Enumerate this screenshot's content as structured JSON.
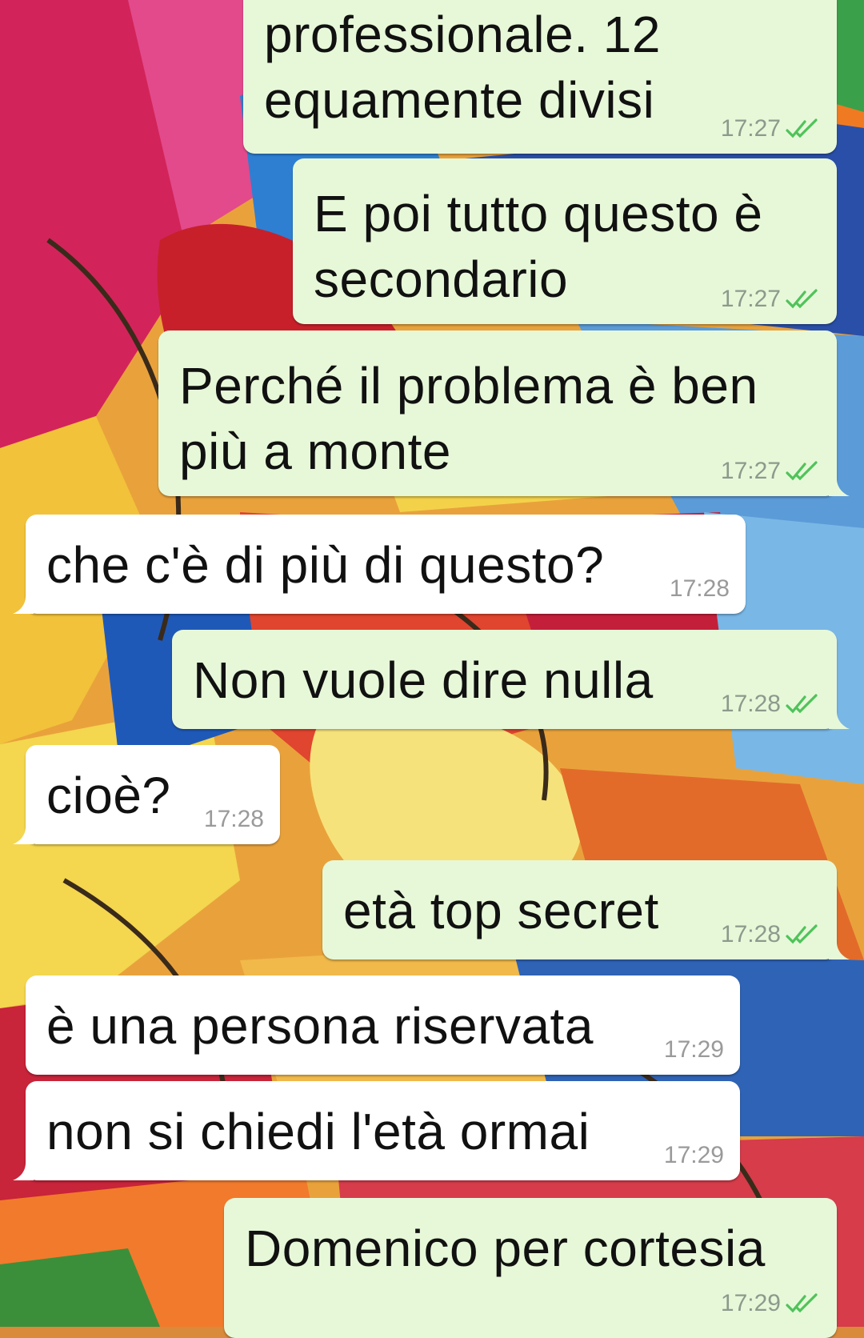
{
  "colors": {
    "outgoing_bubble": "#e7f8d9",
    "incoming_bubble": "#ffffff",
    "read_ticks": "#4fc35a",
    "timestamp": "#8c9a8c"
  },
  "messages": [
    {
      "direction": "outgoing",
      "text": "professionale. 12\nequamente divisi",
      "time": "17:27",
      "status": "read",
      "status_icon": "double-check-icon"
    },
    {
      "direction": "outgoing",
      "text": "E poi tutto questo è\nsecondario",
      "time": "17:27",
      "status": "read",
      "status_icon": "double-check-icon"
    },
    {
      "direction": "outgoing",
      "text": "Perché il problema è ben\npiù a monte",
      "time": "17:27",
      "status": "read",
      "status_icon": "double-check-icon"
    },
    {
      "direction": "incoming",
      "text": "che c'è di più di questo?",
      "time": "17:28"
    },
    {
      "direction": "outgoing",
      "text": "Non vuole dire nulla",
      "time": "17:28",
      "status": "read",
      "status_icon": "double-check-icon"
    },
    {
      "direction": "incoming",
      "text": "cioè?",
      "time": "17:28"
    },
    {
      "direction": "outgoing",
      "text": "età top secret",
      "time": "17:28",
      "status": "read",
      "status_icon": "double-check-icon"
    },
    {
      "direction": "incoming",
      "text": "è una persona riservata",
      "time": "17:29"
    },
    {
      "direction": "incoming",
      "text": "non si chiedi l'età ormai",
      "time": "17:29"
    },
    {
      "direction": "outgoing",
      "text": "Domenico per cortesia",
      "time": "17:29",
      "status": "read",
      "status_icon": "double-check-icon"
    }
  ]
}
